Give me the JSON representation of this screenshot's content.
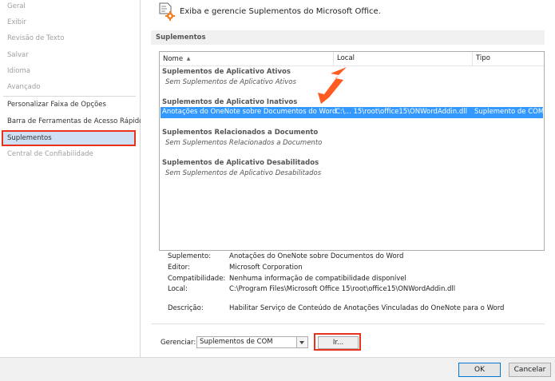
{
  "sidebar": {
    "items": [
      {
        "label": "Geral",
        "disabled": true
      },
      {
        "label": "Exibir",
        "disabled": true
      },
      {
        "label": "Revisão de Texto",
        "disabled": true
      },
      {
        "label": "Salvar",
        "disabled": true
      },
      {
        "label": "Idioma",
        "disabled": true
      },
      {
        "label": "Avançado",
        "disabled": true
      },
      {
        "label": "Personalizar Faixa de Opções",
        "disabled": false
      },
      {
        "label": "Barra de Ferramentas de Acesso Rápido",
        "disabled": false
      },
      {
        "label": "Suplementos",
        "disabled": false,
        "selected": true
      },
      {
        "label": "Central de Confiabilidade",
        "disabled": true
      }
    ]
  },
  "header": {
    "icon": "addins-gear-icon",
    "text": "Exiba e gerencie Suplementos do Microsoft Office."
  },
  "section": {
    "title": "Suplementos"
  },
  "list": {
    "columns": [
      "Nome",
      "Local",
      "Tipo"
    ],
    "sort_indicator": "▲",
    "groups": [
      {
        "title": "Suplementos de Aplicativo Ativos",
        "empty": "Sem Suplementos de Aplicativo Ativos"
      },
      {
        "title": "Suplementos de Aplicativo Inativos"
      },
      {
        "title": "Suplementos Relacionados a Documento",
        "empty": "Sem Suplementos Relacionados a Documento"
      },
      {
        "title": "Suplementos de Aplicativo Desabilitados",
        "empty": "Sem Suplementos de Aplicativo Desabilitados"
      }
    ],
    "selected_row": {
      "name": "Anotações do OneNote sobre Documentos do Word",
      "location": "C:\\... 15\\root\\office15\\ONWordAddin.dll",
      "type": "Suplemento de COM"
    }
  },
  "details": {
    "supplement_label": "Suplemento:",
    "supplement_value": "Anotações do OneNote sobre Documentos do Word",
    "publisher_label": "Editor:",
    "publisher_value": "Microsoft Corporation",
    "compat_label": "Compatibilidade:",
    "compat_value": "Nenhuma informação de compatibilidade disponível",
    "location_label": "Local:",
    "location_value": "C:\\Program Files\\Microsoft Office 15\\root\\office15\\ONWordAddin.dll",
    "description_label": "Descrição:",
    "description_value": "Habilitar Serviço de Conteúdo de Anotações Vinculadas do OneNote para o Word"
  },
  "manage": {
    "label": "Gerenciar:",
    "selected": "Suplementos de COM",
    "go_label": "Ir..."
  },
  "footer": {
    "ok_label": "OK",
    "cancel_label": "Cancelar"
  },
  "colors": {
    "highlight": "#e8321e",
    "selection": "#3399ff",
    "arrow": "#ff5a1f"
  }
}
